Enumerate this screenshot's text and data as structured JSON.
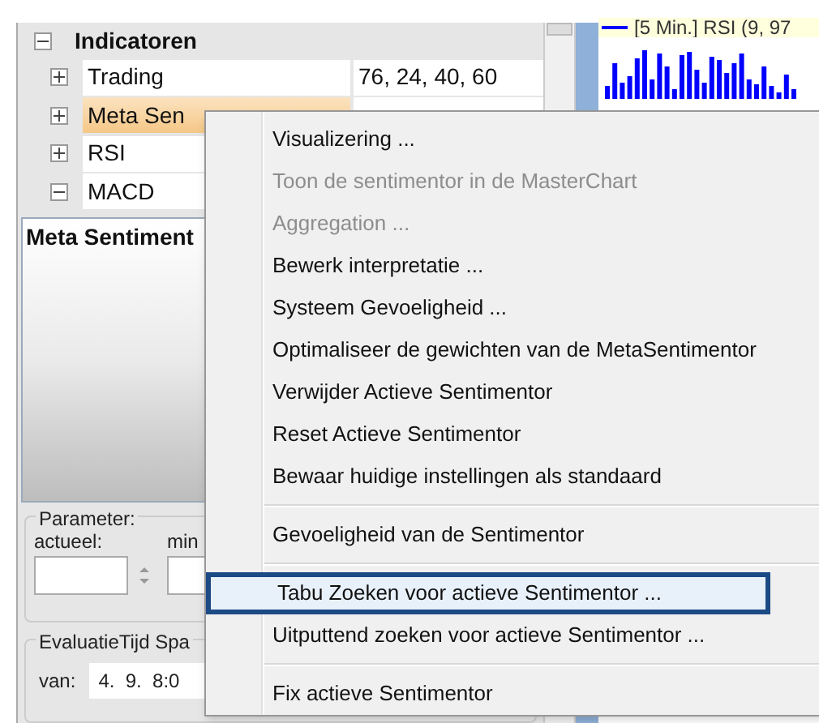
{
  "tree": {
    "title": "Indicatoren",
    "expanded": true,
    "rows": [
      {
        "name": "Trading",
        "value": "76, 24, 40, 60",
        "expanded": false,
        "selected": false
      },
      {
        "name": "Meta Sen",
        "value": "",
        "expanded": false,
        "selected": true
      },
      {
        "name": "RSI",
        "value": "",
        "expanded": false,
        "selected": false
      },
      {
        "name": "MACD",
        "value": "",
        "expanded": true,
        "selected": false
      }
    ]
  },
  "detail_panel": {
    "title": "Meta Sentiment"
  },
  "parameter_group": {
    "title": "Parameter:",
    "fields": [
      {
        "label": "actueel:"
      },
      {
        "label": "min"
      }
    ]
  },
  "evaluation_group": {
    "title": "EvaluatieTijd Spa",
    "from_label": "van:",
    "from_value": "4.  9.  8:0"
  },
  "chart": {
    "legend": "[5 Min.] RSI (9, 97"
  },
  "context_menu": {
    "items": [
      {
        "kind": "item",
        "label": "Visualizering ...",
        "disabled": false,
        "selected": false
      },
      {
        "kind": "item",
        "label": "Toon de sentimentor in de MasterChart",
        "disabled": true,
        "selected": false
      },
      {
        "kind": "item",
        "label": "Aggregation ...",
        "disabled": true,
        "selected": false
      },
      {
        "kind": "item",
        "label": "Bewerk interpretatie ...",
        "disabled": false,
        "selected": false
      },
      {
        "kind": "item",
        "label": "Systeem Gevoeligheid ...",
        "disabled": false,
        "selected": false
      },
      {
        "kind": "item",
        "label": "Optimaliseer de gewichten van de MetaSentimentor",
        "disabled": false,
        "selected": false
      },
      {
        "kind": "item",
        "label": "Verwijder Actieve Sentimentor",
        "disabled": false,
        "selected": false
      },
      {
        "kind": "item",
        "label": "Reset Actieve Sentimentor",
        "disabled": false,
        "selected": false
      },
      {
        "kind": "item",
        "label": "Bewaar huidige instellingen als standaard",
        "disabled": false,
        "selected": false
      },
      {
        "kind": "separator"
      },
      {
        "kind": "item",
        "label": "Gevoeligheid van de Sentimentor",
        "disabled": false,
        "selected": false
      },
      {
        "kind": "separator"
      },
      {
        "kind": "item",
        "label": "Tabu Zoeken voor actieve Sentimentor ...",
        "disabled": false,
        "selected": true
      },
      {
        "kind": "item",
        "label": "Uitputtend zoeken voor actieve Sentimentor ...",
        "disabled": false,
        "selected": false
      },
      {
        "kind": "separator"
      },
      {
        "kind": "item",
        "label": "Fix actieve Sentimentor",
        "disabled": false,
        "selected": false
      }
    ]
  }
}
